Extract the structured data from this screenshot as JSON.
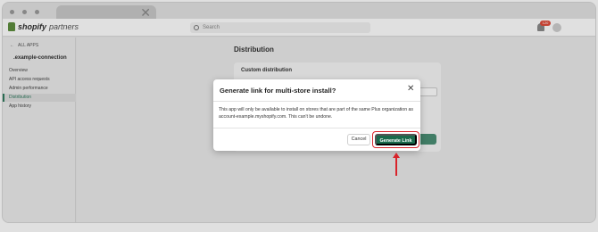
{
  "topbar": {
    "logo_text": "shopify",
    "logo_sub": "partners",
    "search_placeholder": "Search",
    "notification_count": "120"
  },
  "sidebar": {
    "back_label": "ALL APPS",
    "app_name": ".example-connection",
    "items": [
      {
        "label": "Overview",
        "active": false
      },
      {
        "label": "API access requests",
        "active": false
      },
      {
        "label": "Admin performance",
        "active": false
      },
      {
        "label": "Distribution",
        "active": true
      },
      {
        "label": "App history",
        "active": false
      }
    ]
  },
  "main": {
    "page_title": "Distribution",
    "card_title": "Custom distribution"
  },
  "modal": {
    "title": "Generate link for multi-store install?",
    "body": "This app will only be available to install on stores that are part of the same Plus organization as account-example.myshopify.com. This can't be undone.",
    "cancel_label": "Cancel",
    "confirm_label": "Generate Link"
  },
  "colors": {
    "accent": "#1a6a4c",
    "highlight": "#d8232a"
  }
}
